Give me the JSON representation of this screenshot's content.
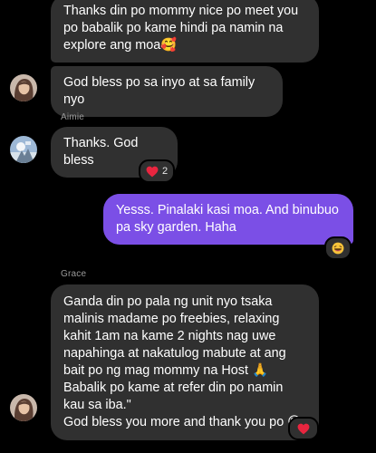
{
  "messages": [
    {
      "text": "Thanks din po mommy nice po meet you po babalik po kame hindi pa namin na explore ang moa🥰"
    },
    {
      "text": "God bless po sa inyo at sa family nyo"
    },
    {
      "sender": "Aimie",
      "text": "Thanks. God bless",
      "reaction_count": "2"
    },
    {
      "text": "Yesss. Pinalaki kasi moa. And binubuo pa sky garden. Haha"
    },
    {
      "sender": "Grace",
      "text": "Ganda din po pala ng unit nyo tsaka malinis madame po freebies, relaxing kahit 1am na kame 2 nights nag uwe napahinga at nakatulog mabute at ang bait po ng mag mommy na Host 🙏\nBabalik po kame at refer din po namin kau sa iba.\"\nGod bless you more and thank you po 😊"
    }
  ],
  "colors": {
    "background": "#000000",
    "incoming_bubble": "#303030",
    "outgoing_bubble": "#7b4fe6",
    "heart": "#e8253f",
    "sender_name": "#9a9a9a"
  },
  "icons": {
    "avatar_grace": "avatar-icon",
    "avatar_aimie": "avatar-icon",
    "reaction_heart": "heart-icon",
    "reaction_laugh": "laughing-face-icon"
  }
}
